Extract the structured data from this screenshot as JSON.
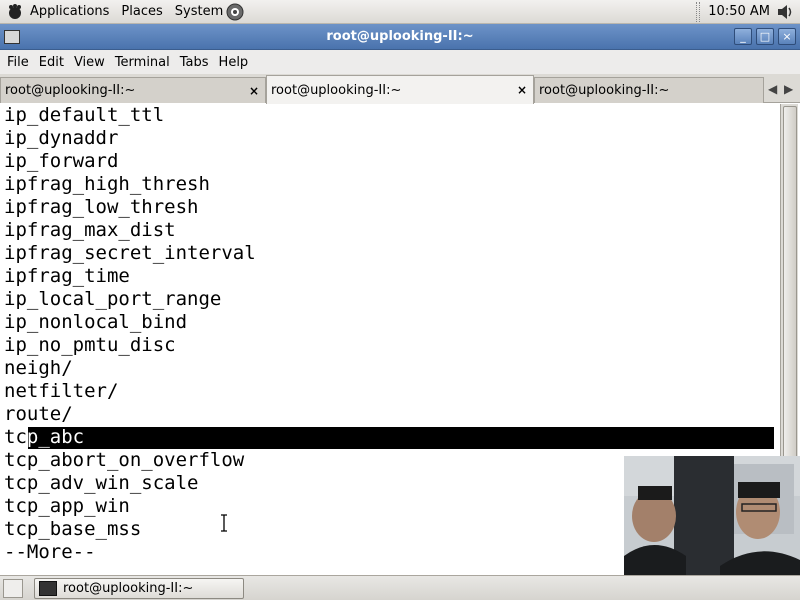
{
  "top_panel": {
    "menus": [
      "Applications",
      "Places",
      "System"
    ],
    "clock": "10:50 AM"
  },
  "window": {
    "title": "root@uplooking-II:~",
    "menu": [
      "File",
      "Edit",
      "View",
      "Terminal",
      "Tabs",
      "Help"
    ],
    "tabs": [
      {
        "label": "root@uplooking-II:~",
        "close": "×",
        "active": false
      },
      {
        "label": "root@uplooking-II:~",
        "close": "×",
        "active": true
      },
      {
        "label": "root@uplooking-II:~",
        "active": false
      }
    ]
  },
  "terminal": {
    "lines": [
      "ip_default_ttl",
      "ip_dynaddr",
      "ip_forward",
      "ipfrag_high_thresh",
      "ipfrag_low_thresh",
      "ipfrag_max_dist",
      "ipfrag_secret_interval",
      "ipfrag_time",
      "ip_local_port_range",
      "ip_nonlocal_bind",
      "ip_no_pmtu_disc",
      "neigh/",
      "netfilter/",
      "route/",
      "tcp_abc",
      "tcp_abort_on_overflow",
      "tcp_adv_win_scale",
      "tcp_app_win",
      "tcp_base_mss",
      "--More--"
    ],
    "highlight_prefix": "tc",
    "highlight_selected": "p_abc"
  },
  "taskbar": {
    "task_label": "root@uplooking-II:~"
  },
  "colors": {
    "titlebar": "#5a82bb",
    "highlight": "#000000"
  }
}
